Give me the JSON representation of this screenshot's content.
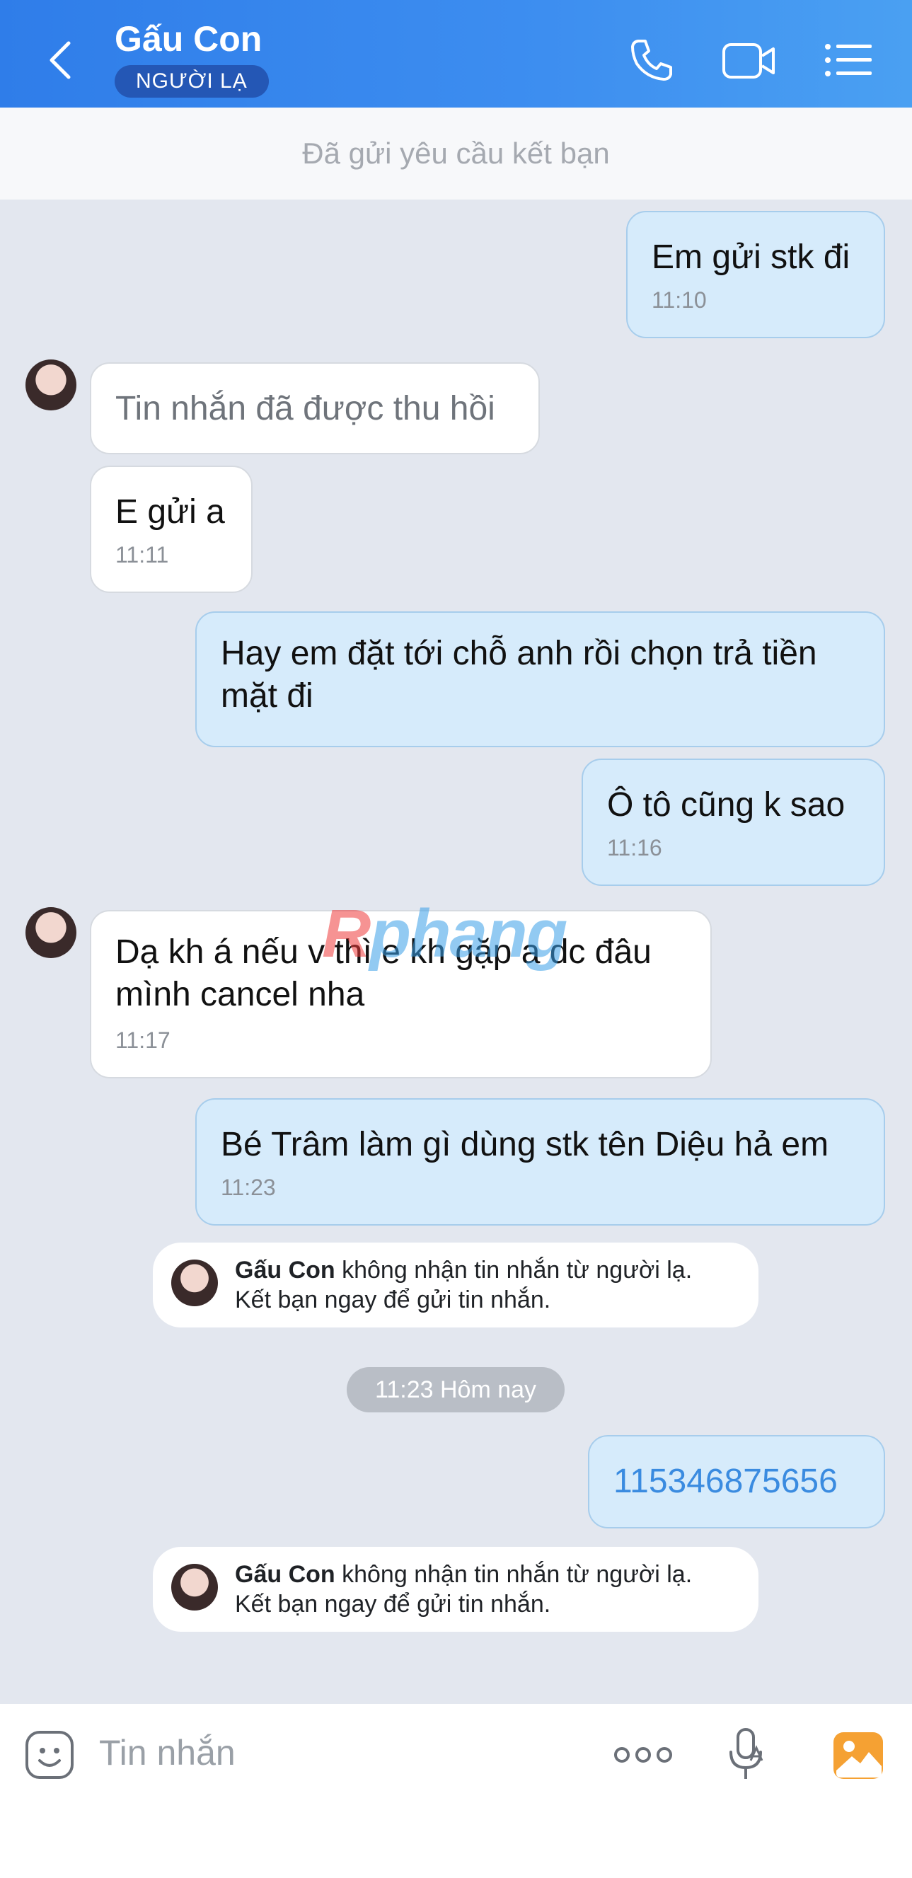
{
  "header": {
    "title": "Gấu Con",
    "badge": "NGƯỜI LẠ",
    "icons": [
      "back-arrow-icon",
      "phone-icon",
      "video-call-icon",
      "menu-list-icon"
    ]
  },
  "notice": "Đã gửi yêu cầu kết bạn",
  "messages": [
    {
      "text": "Em gửi stk đi",
      "time": "11:10"
    },
    {
      "text": "Tin nhắn đã được thu hồi"
    },
    {
      "text": "E gửi a",
      "time": "11:11"
    },
    {
      "text": "Hay em đặt tới chỗ anh rồi chọn trả tiền mặt đi"
    },
    {
      "text": "Ô tô cũng k sao",
      "time": "11:16"
    },
    {
      "text": "Dạ kh á nếu v thì e kh gặp a dc đâu mình cancel nha",
      "time": "11:17"
    },
    {
      "text": "Bé Trâm làm gì dùng stk tên Diệu hả em",
      "time": "11:23"
    },
    {
      "text": "115346875656"
    }
  ],
  "system_messages": [
    {
      "name": "Gấu Con",
      "line1": " không nhận tin nhắn từ người lạ.",
      "line2": "Kết bạn ngay để gửi tin nhắn."
    },
    {
      "name": "Gấu Con",
      "line1": " không nhận tin nhắn từ người lạ.",
      "line2": "Kết bạn ngay để gửi tin nhắn."
    }
  ],
  "time_divider": "11:23 Hôm nay",
  "watermark": {
    "first": "R",
    "rest": "phang"
  },
  "input": {
    "placeholder": "Tin nhắn",
    "icons": [
      "emoji-icon",
      "more-options-icon",
      "voice-to-text-icon",
      "image-gallery-icon"
    ]
  },
  "colors": {
    "header": "#3d8ef0",
    "outgoing_bubble": "#d6ebfb",
    "incoming_bubble": "#ffffff",
    "background": "#e3e7ef",
    "link": "#3a8be0",
    "badge": "#2457b5"
  }
}
